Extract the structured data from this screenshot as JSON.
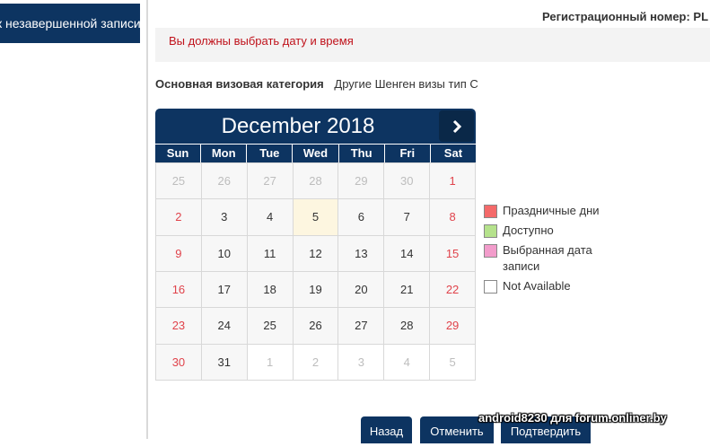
{
  "sidebar": {
    "resume_button": "к незавершенной записи"
  },
  "header": {
    "registration_label": "Регистрационный номер: PL"
  },
  "alert": {
    "message": "Вы должны выбрать дату и время"
  },
  "visa": {
    "label": "Основная визовая категория",
    "value": "Другие Шенген визы тип С"
  },
  "calendar": {
    "title": "December 2018",
    "next_icon": "chevron-right-icon",
    "weekdays": [
      "Sun",
      "Mon",
      "Tue",
      "Wed",
      "Thu",
      "Fri",
      "Sat"
    ],
    "weeks": [
      [
        "25",
        "26",
        "27",
        "28",
        "29",
        "30",
        "1"
      ],
      [
        "2",
        "3",
        "4",
        "5",
        "6",
        "7",
        "8"
      ],
      [
        "9",
        "10",
        "11",
        "12",
        "13",
        "14",
        "15"
      ],
      [
        "16",
        "17",
        "18",
        "19",
        "20",
        "21",
        "22"
      ],
      [
        "23",
        "24",
        "25",
        "26",
        "27",
        "28",
        "29"
      ],
      [
        "30",
        "31",
        "1",
        "2",
        "3",
        "4",
        "5"
      ]
    ],
    "today": "5"
  },
  "legend": [
    {
      "label": "Праздничные дни",
      "color": "#f46a6a"
    },
    {
      "label": "Доступно",
      "color": "#b5e28c"
    },
    {
      "label": "Выбранная дата записи",
      "color": "#f29ccb"
    },
    {
      "label": "Not Available",
      "color": "#ffffff"
    }
  ],
  "actions": {
    "back": "Назад",
    "cancel": "Отменить",
    "confirm": "Подтвердить"
  },
  "watermark": "android8230 для forum.onliner.by",
  "colors": {
    "primary": "#0d3461",
    "error": "#c0121b",
    "weekend": "#e0434b"
  }
}
